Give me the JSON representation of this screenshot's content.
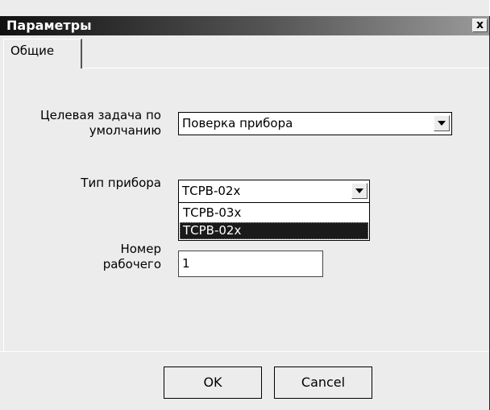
{
  "window": {
    "title": "Параметры",
    "close_label": "x"
  },
  "tabs": [
    {
      "label": "Общие"
    }
  ],
  "fields": {
    "default_task": {
      "label_line1": "Целевая задача по",
      "label_line2": "умолчанию",
      "value": "Поверка прибора"
    },
    "device_type": {
      "label": "Тип прибора",
      "value": "ТСРВ-02х",
      "options": [
        "ТСРВ-03х",
        "ТСРВ-02х"
      ],
      "highlighted_option": "ТСРВ-02х"
    },
    "worker_number": {
      "label_line1": "Номер",
      "label_line2": "рабочего",
      "value": "1"
    }
  },
  "buttons": {
    "ok": "OK",
    "cancel": "Cancel"
  },
  "icons": {
    "dropdown": "chevron-down-icon",
    "close": "close-icon"
  }
}
